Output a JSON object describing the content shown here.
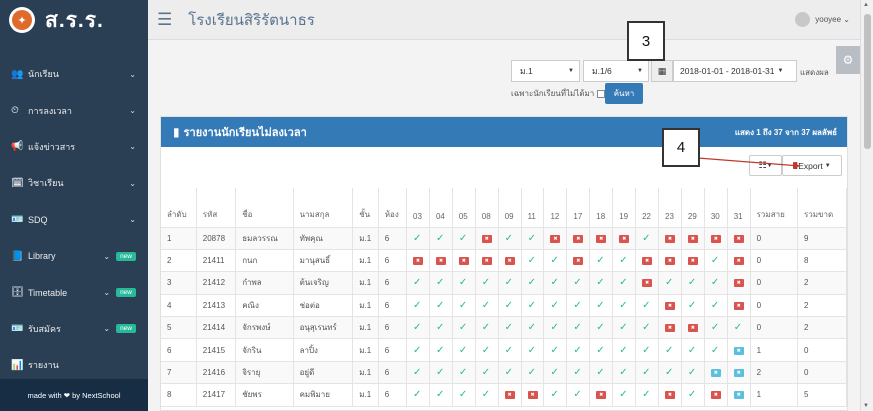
{
  "brand": {
    "name": "ส.ร.ร.",
    "footer": "made with ❤ by NextSchool"
  },
  "sidebar": {
    "items": [
      {
        "label": "นักเรียน",
        "icon": "users-icon",
        "glyph": "👥",
        "badge": ""
      },
      {
        "label": "การลงเวลา",
        "icon": "clock-icon",
        "glyph": "⏲",
        "badge": ""
      },
      {
        "label": "แจ้งข่าวสาร",
        "icon": "megaphone-icon",
        "glyph": "📢",
        "badge": ""
      },
      {
        "label": "วิชาเรียน",
        "icon": "calendar-check-icon",
        "glyph": "🗓",
        "badge": ""
      },
      {
        "label": "SDQ",
        "icon": "id-card-icon",
        "glyph": "🪪",
        "badge": ""
      },
      {
        "label": "Library",
        "icon": "book-icon",
        "glyph": "📘",
        "badge": "new"
      },
      {
        "label": "Timetable",
        "icon": "database-icon",
        "glyph": "🗄",
        "badge": "new"
      },
      {
        "label": "รับสมัคร",
        "icon": "id-card-icon",
        "glyph": "🪪",
        "badge": "new"
      },
      {
        "label": "รายงาน",
        "icon": "bar-chart-icon",
        "glyph": "📊",
        "badge": ""
      }
    ]
  },
  "header": {
    "school": "โรงเรียนสิริรัตนาธร",
    "user": "yooyee"
  },
  "filters": {
    "level": "ม.1",
    "room": "ม.1/6",
    "date_range": "2018-01-01 - 2018-01-31",
    "show_label": "แสดงผล",
    "only_absent_label": "เฉพาะนักเรียนที่ไม่ได้มา",
    "search_label": "ค้นหา"
  },
  "callouts": {
    "c3": "3",
    "c4": "4"
  },
  "panel": {
    "title": "รายงานนักเรียนไม่ลงเวลา",
    "info": "แสดง 1 ถึง 37 จาก 37 ผลลัพธ์",
    "export_label": "Export"
  },
  "table": {
    "columns": [
      "ลำดับ",
      "รหัส",
      "ชื่อ",
      "นามสกุล",
      "ชั้น",
      "ห้อง",
      "03",
      "04",
      "05",
      "08",
      "09",
      "11",
      "12",
      "17",
      "18",
      "19",
      "22",
      "23",
      "29",
      "30",
      "31",
      "รวมสาย",
      "รวมขาด"
    ],
    "rows": [
      {
        "no": "1",
        "id": "20878",
        "first": "ธมลวรรณ",
        "last": "ทัพคุณ",
        "level": "ม.1",
        "room": "6",
        "days": [
          "ok",
          "ok",
          "ok",
          "ab",
          "ok",
          "ok",
          "ab",
          "ab",
          "ab",
          "ab",
          "ok",
          "ab",
          "ab",
          "ab",
          "ab"
        ],
        "late": "0",
        "absent": "9"
      },
      {
        "no": "2",
        "id": "21411",
        "first": "กนก",
        "last": "มานุสนธิ์",
        "level": "ม.1",
        "room": "6",
        "days": [
          "ab",
          "ab",
          "ab",
          "ab",
          "ab",
          "ok",
          "ok",
          "ab",
          "ok",
          "ok",
          "ab",
          "ab",
          "ab",
          "ok",
          "ab"
        ],
        "late": "0",
        "absent": "8"
      },
      {
        "no": "3",
        "id": "21412",
        "first": "กำพล",
        "last": "ต้นเจริญ",
        "level": "ม.1",
        "room": "6",
        "days": [
          "ok",
          "ok",
          "ok",
          "ok",
          "ok",
          "ok",
          "ok",
          "ok",
          "ok",
          "ok",
          "ab",
          "ok",
          "ok",
          "ok",
          "ab"
        ],
        "late": "0",
        "absent": "2"
      },
      {
        "no": "4",
        "id": "21413",
        "first": "คณิง",
        "last": "ช่อต่อ",
        "level": "ม.1",
        "room": "6",
        "days": [
          "ok",
          "ok",
          "ok",
          "ok",
          "ok",
          "ok",
          "ok",
          "ok",
          "ok",
          "ok",
          "ok",
          "ab",
          "ok",
          "ok",
          "ab"
        ],
        "late": "0",
        "absent": "2"
      },
      {
        "no": "5",
        "id": "21414",
        "first": "จักรพงษ์",
        "last": "อนุสุเรนทร์",
        "level": "ม.1",
        "room": "6",
        "days": [
          "ok",
          "ok",
          "ok",
          "ok",
          "ok",
          "ok",
          "ok",
          "ok",
          "ok",
          "ok",
          "ok",
          "ab",
          "ab",
          "ok",
          "ok"
        ],
        "late": "0",
        "absent": "2"
      },
      {
        "no": "6",
        "id": "21415",
        "first": "จักริน",
        "last": "ลาปิ้ง",
        "level": "ม.1",
        "room": "6",
        "days": [
          "ok",
          "ok",
          "ok",
          "ok",
          "ok",
          "ok",
          "ok",
          "ok",
          "ok",
          "ok",
          "ok",
          "ok",
          "ok",
          "ok",
          "lt"
        ],
        "late": "1",
        "absent": "0"
      },
      {
        "no": "7",
        "id": "21416",
        "first": "จิรายุ",
        "last": "อยู่ดี",
        "level": "ม.1",
        "room": "6",
        "days": [
          "ok",
          "ok",
          "ok",
          "ok",
          "ok",
          "ok",
          "ok",
          "ok",
          "ok",
          "ok",
          "ok",
          "ok",
          "ok",
          "lt",
          "lt"
        ],
        "late": "2",
        "absent": "0"
      },
      {
        "no": "8",
        "id": "21417",
        "first": "ชัยพร",
        "last": "คมพิมาย",
        "level": "ม.1",
        "room": "6",
        "days": [
          "ok",
          "ok",
          "ok",
          "ok",
          "ab",
          "ab",
          "ok",
          "ok",
          "ab",
          "ok",
          "ok",
          "ab",
          "ok",
          "ab",
          "lt"
        ],
        "late": "1",
        "absent": "5"
      }
    ]
  }
}
